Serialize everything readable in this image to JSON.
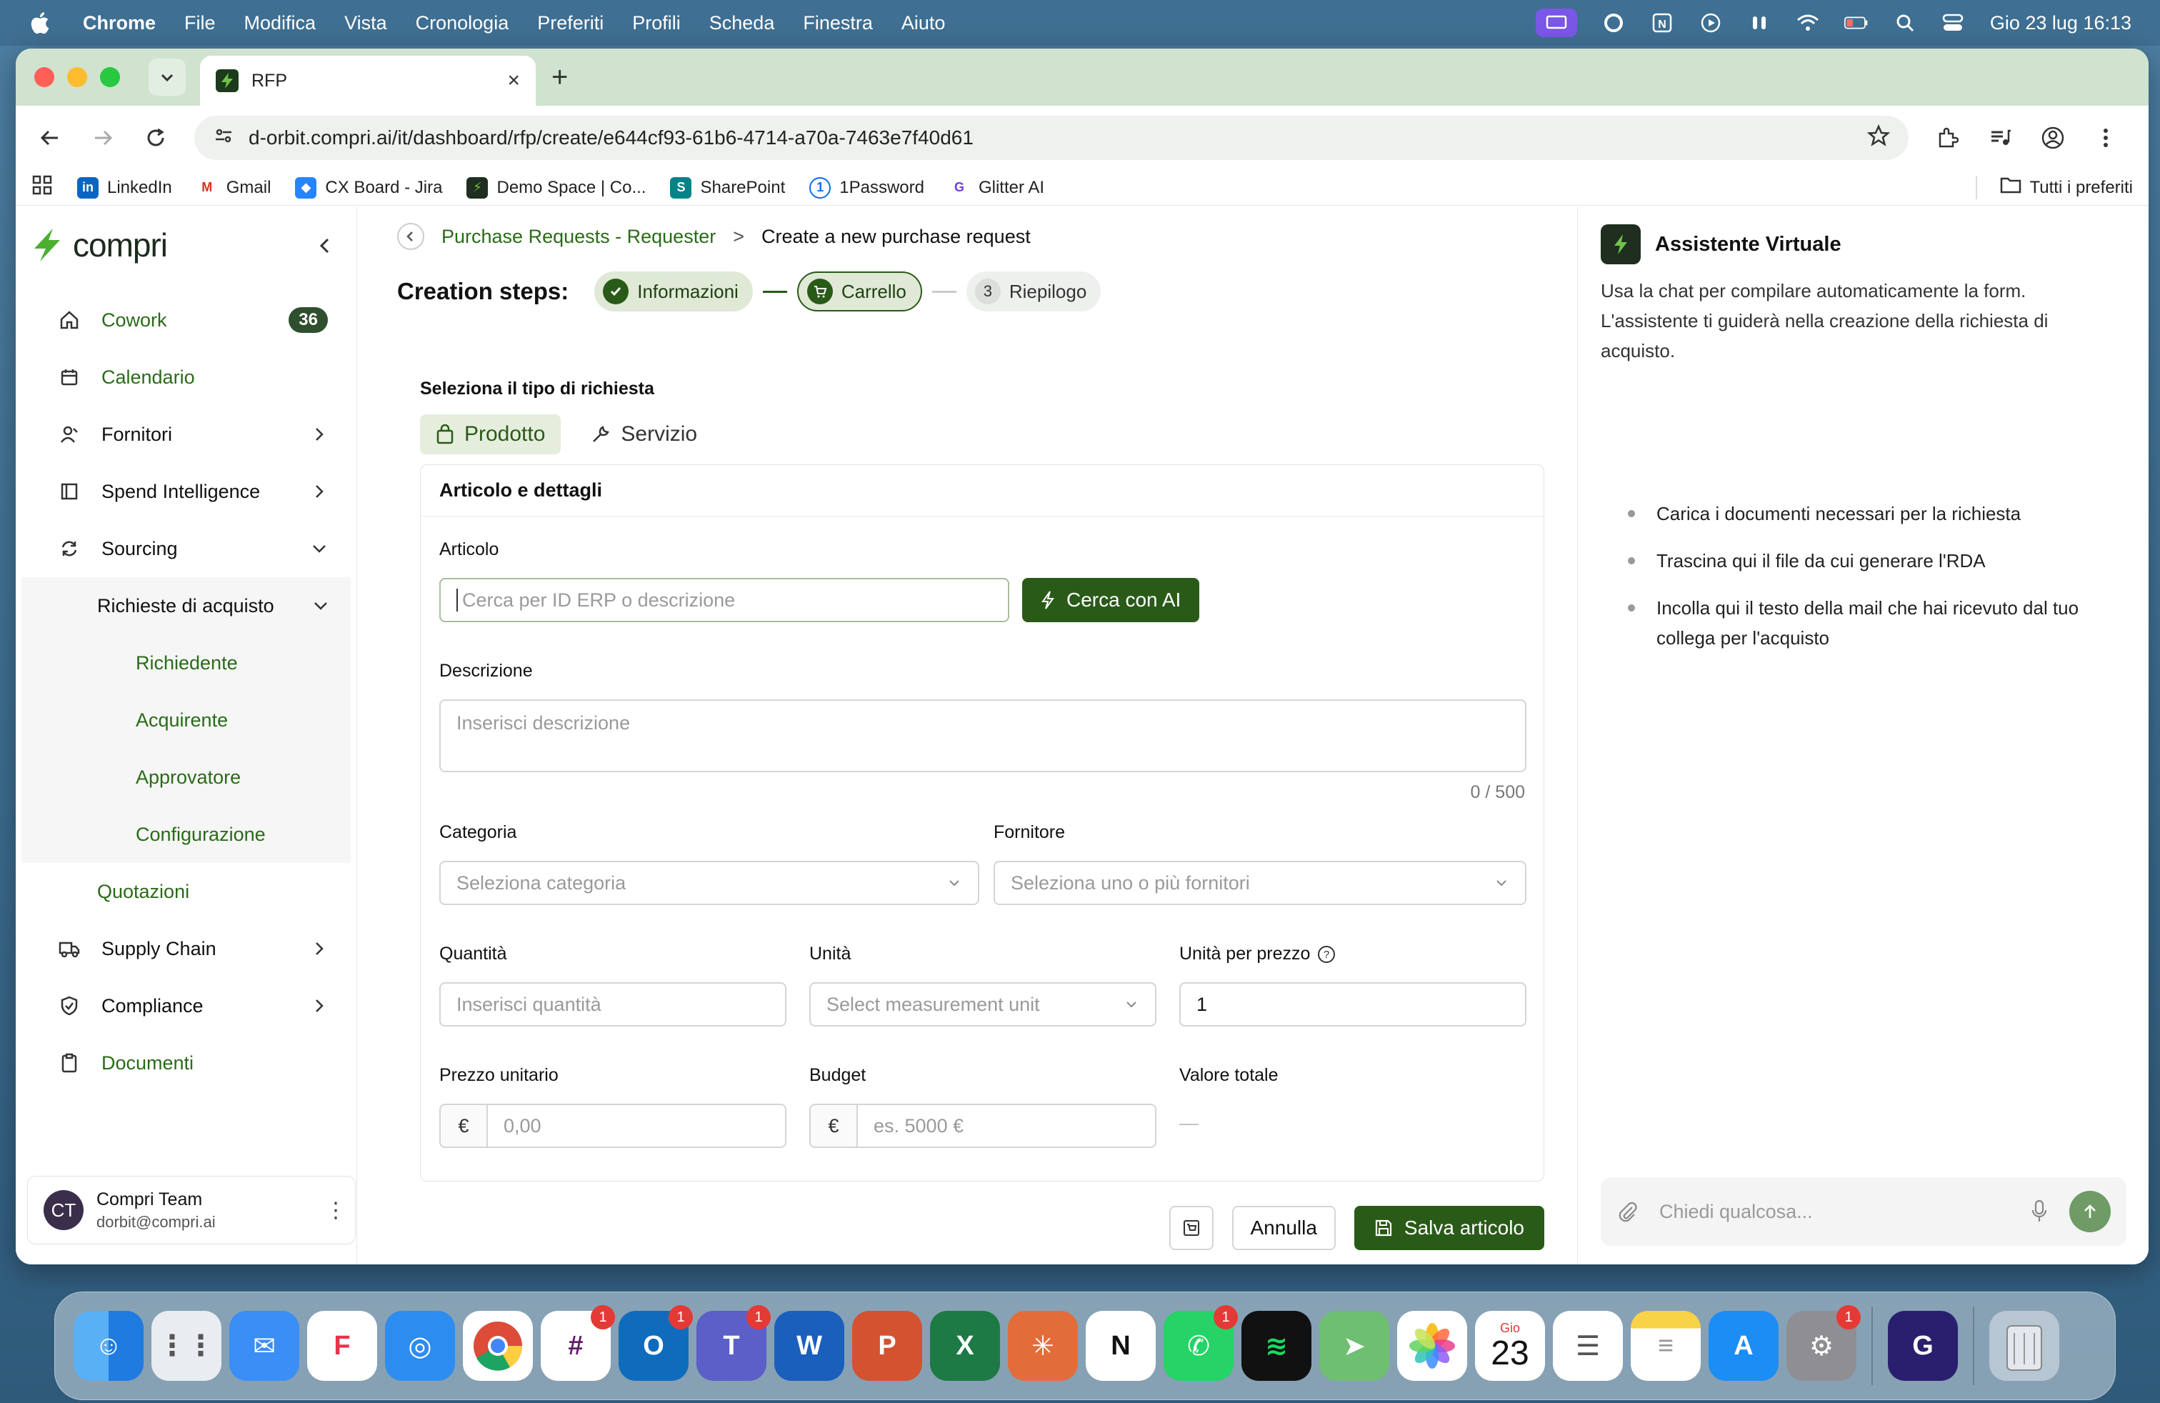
{
  "menubar": {
    "items": [
      "Chrome",
      "File",
      "Modifica",
      "Vista",
      "Cronologia",
      "Preferiti",
      "Profili",
      "Scheda",
      "Finestra",
      "Aiuto"
    ],
    "clock": "Gio 23 lug  16:13"
  },
  "browser": {
    "tab_title": "RFP",
    "url": "d-orbit.compri.ai/it/dashboard/rfp/create/e644cf93-61b6-4714-a70a-7463e7f40d61",
    "bookmarks": [
      "LinkedIn",
      "Gmail",
      "CX Board - Jira",
      "Demo Space | Co...",
      "SharePoint",
      "1Password",
      "Glitter AI"
    ],
    "all_bookmarks": "Tutti i preferiti"
  },
  "sidebar": {
    "logo": "compri",
    "items": {
      "cowork": "Cowork",
      "cowork_badge": "36",
      "calendario": "Calendario",
      "fornitori": "Fornitori",
      "spend": "Spend Intelligence",
      "sourcing": "Sourcing",
      "richieste": "Richieste di acquisto",
      "richiedente": "Richiedente",
      "acquirente": "Acquirente",
      "approvatore": "Approvatore",
      "configurazione": "Configurazione",
      "quotazioni": "Quotazioni",
      "supply": "Supply Chain",
      "compliance": "Compliance",
      "documenti": "Documenti"
    },
    "user": {
      "initials": "CT",
      "name": "Compri Team",
      "email": "dorbit@compri.ai"
    }
  },
  "main": {
    "breadcrumb": {
      "parent": "Purchase Requests - Requester",
      "sep": ">",
      "current": "Create a new purchase request"
    },
    "steps_title": "Creation steps:",
    "steps": [
      {
        "label": "Informazioni",
        "state": "done"
      },
      {
        "label": "Carrello",
        "state": "active"
      },
      {
        "label": "Riepilogo",
        "state": "todo",
        "num": "3"
      }
    ],
    "type_label": "Seleziona il tipo di richiesta",
    "types": {
      "product": "Prodotto",
      "service": "Servizio"
    },
    "card_title": "Articolo e dettagli",
    "articolo": {
      "label": "Articolo",
      "placeholder": "Cerca per ID ERP o descrizione",
      "ai_button": "Cerca con AI"
    },
    "descrizione": {
      "label": "Descrizione",
      "placeholder": "Inserisci descrizione",
      "counter": "0 / 500"
    },
    "categoria": {
      "label": "Categoria",
      "placeholder": "Seleziona categoria"
    },
    "fornitore": {
      "label": "Fornitore",
      "placeholder": "Seleziona uno o più fornitori"
    },
    "quantita": {
      "label": "Quantità",
      "placeholder": "Inserisci quantità"
    },
    "unita": {
      "label": "Unità",
      "placeholder": "Select measurement unit"
    },
    "unita_prezzo": {
      "label": "Unità per prezzo",
      "value": "1"
    },
    "prezzo": {
      "label": "Prezzo unitario",
      "currency": "€",
      "placeholder": "0,00"
    },
    "budget": {
      "label": "Budget",
      "currency": "€",
      "placeholder": "es. 5000 €"
    },
    "valore": {
      "label": "Valore totale",
      "value": "—"
    },
    "buttons": {
      "cancel": "Annulla",
      "save": "Salva articolo"
    }
  },
  "assistant": {
    "title": "Assistente Virtuale",
    "description": "Usa la chat per compilare automaticamente la form. L'assistente ti guiderà nella creazione della richiesta di acquisto.",
    "tips": [
      "Carica i documenti necessari per la richiesta",
      "Trascina qui il file da cui generare l'RDA",
      "Incolla qui il testo della mail che hai ricevuto dal tuo collega per l'acquisto"
    ],
    "chat_placeholder": "Chiedi qualcosa..."
  },
  "dock": {
    "calendar_month": "Gio",
    "calendar_day": "23",
    "badges": {
      "slack": "1",
      "outlook": "1",
      "teams": "1",
      "whatsapp": "1",
      "settings": "1"
    }
  },
  "colors": {
    "brand_green": "#2a5a18",
    "link_green": "#2a6b19",
    "menubar": "#3f6f92"
  }
}
